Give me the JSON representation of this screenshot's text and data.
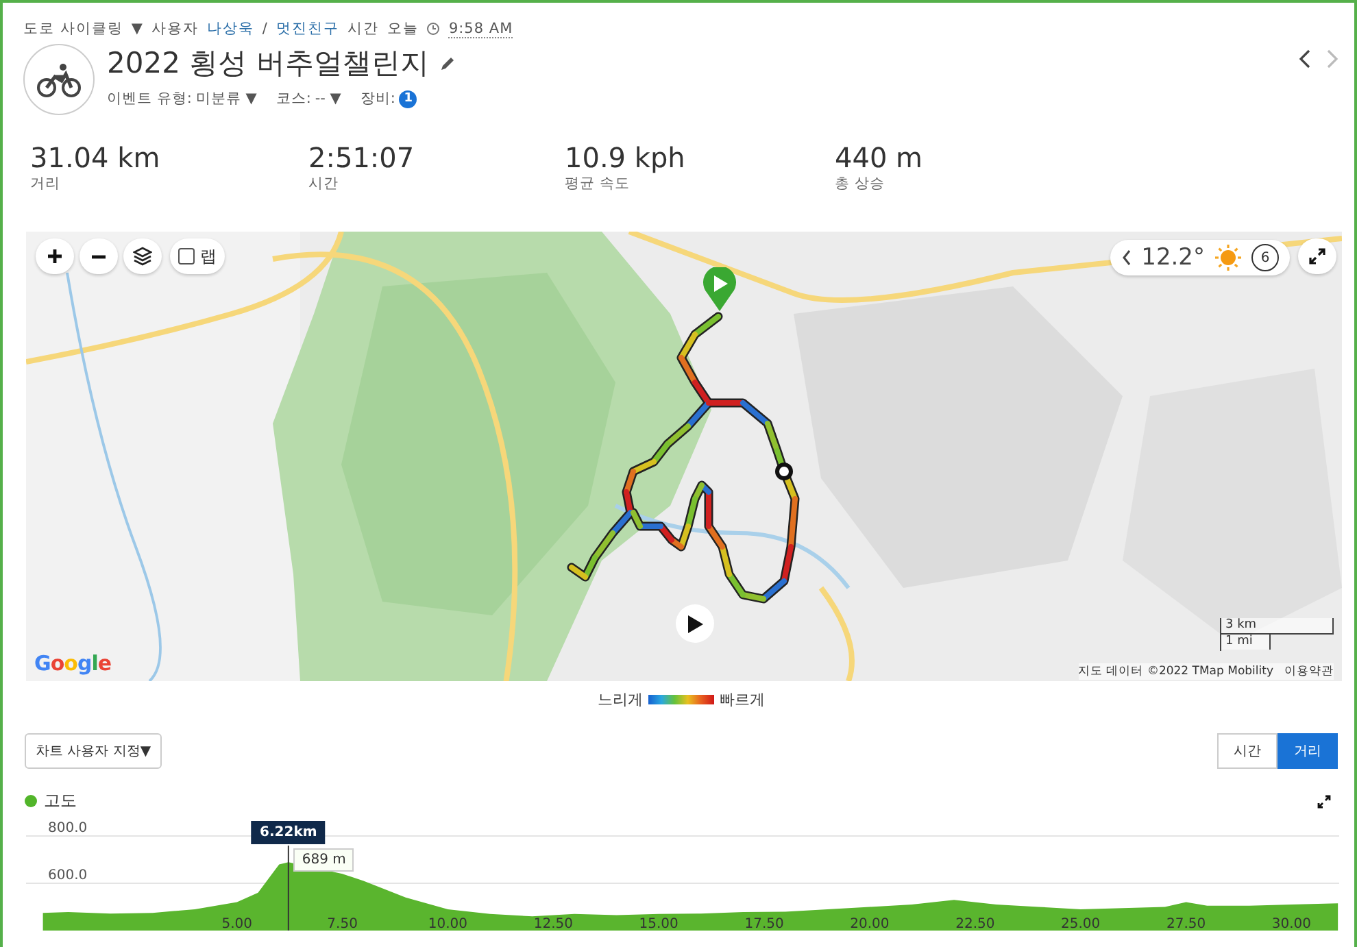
{
  "header": {
    "activity_type": "도로 사이클링",
    "type_caret": "▼",
    "user_label": "사용자",
    "user_name": "나상욱",
    "separator": "/",
    "nickname": "멋진친구",
    "time_label": "시간",
    "day": "오늘",
    "time": "9:58 AM"
  },
  "title": "2022 횡성 버추얼챌린지",
  "meta": [
    {
      "kind": "dropdown",
      "label": "이벤트 유형:",
      "value": "미분류",
      "caret": "▼"
    },
    {
      "kind": "dropdown",
      "label": "코스:",
      "value": "--",
      "caret": "▼"
    },
    {
      "kind": "badge",
      "label": "장비:",
      "value": "1"
    }
  ],
  "nav": {
    "prev_disabled": false,
    "next_disabled": true
  },
  "stats": [
    {
      "value": "31.04 km",
      "label": "거리"
    },
    {
      "value": "2:51:07",
      "label": "시간"
    },
    {
      "value": "10.9 kph",
      "label": "평균 속도"
    },
    {
      "value": "440 m",
      "label": "총 상승"
    }
  ],
  "map": {
    "kind": "picture",
    "layers_checkbox": {
      "label": "랩",
      "checked": false
    },
    "weather": {
      "temperature": "12.2°",
      "wind": "6"
    },
    "scale": {
      "metric": "3 km",
      "imperial": "1 mi"
    },
    "logo": "Google",
    "attribution": "지도 데이터 ©2022 TMap Mobility",
    "terms": "이용약관"
  },
  "legend": {
    "slow": "느리게",
    "fast": "빠르게"
  },
  "chart_menu": {
    "label": "차트 사용자 지정▼"
  },
  "axis_tabs": [
    {
      "label": "시간",
      "selected": false
    },
    {
      "label": "거리",
      "selected": true
    }
  ],
  "elevation": {
    "color": "#52b52a",
    "tooltip": {
      "distance": "6.22km",
      "value": "689 m"
    },
    "chart_data": {
      "type": "area",
      "x": [
        0.4,
        1,
        2,
        3,
        4,
        5,
        5.5,
        6,
        6.22,
        7.5,
        8,
        9,
        10,
        11,
        12,
        13,
        14,
        15,
        16,
        17,
        18,
        19,
        20,
        21,
        22,
        23,
        24,
        25,
        26,
        27,
        27.5,
        28,
        29,
        30,
        31.1
      ],
      "series": [
        {
          "name": "고도",
          "color": "#5ab52e",
          "values": [
            475,
            478,
            472,
            475,
            490,
            520,
            560,
            680,
            689,
            640,
            610,
            540,
            490,
            470,
            460,
            470,
            465,
            470,
            472,
            478,
            480,
            490,
            500,
            510,
            530,
            510,
            500,
            490,
            495,
            500,
            520,
            505,
            505,
            510,
            515
          ]
        }
      ],
      "xlim": [
        0,
        31.13
      ],
      "ylim": [
        400,
        800
      ],
      "xticks": [
        {
          "value": 5,
          "label": "5.00"
        },
        {
          "value": 7.5,
          "label": "7.50"
        },
        {
          "value": 10,
          "label": "10.00"
        },
        {
          "value": 12.5,
          "label": "12.50"
        },
        {
          "value": 15,
          "label": "15.00"
        },
        {
          "value": 17.5,
          "label": "17.50"
        },
        {
          "value": 20,
          "label": "20.00"
        },
        {
          "value": 22.5,
          "label": "22.50"
        },
        {
          "value": 25,
          "label": "25.00"
        },
        {
          "value": 27.5,
          "label": "27.50"
        },
        {
          "value": 30,
          "label": "30.00"
        }
      ],
      "yticks": [
        {
          "value": 600,
          "label": "600.0"
        },
        {
          "value": 800,
          "label": "800.0"
        }
      ],
      "ref_lines": [
        {
          "axis": "x",
          "value": 6.22
        }
      ]
    }
  }
}
